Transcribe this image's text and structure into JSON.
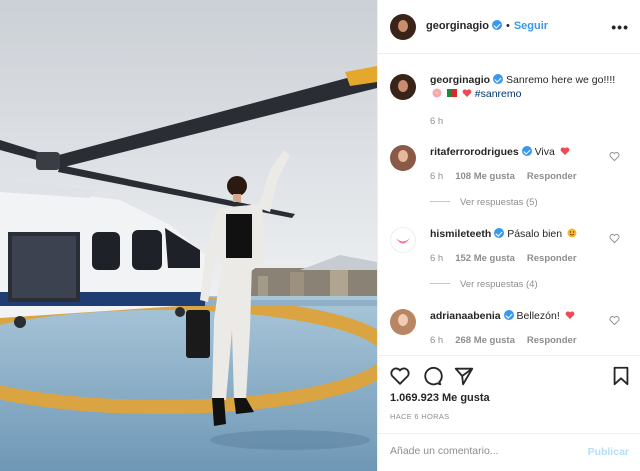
{
  "post": {
    "image_alt": "Woman posing in front of a helicopter on a helipad"
  },
  "header": {
    "username": "georginagio",
    "separator": "•",
    "follow_label": "Seguir",
    "more_label": "•••"
  },
  "caption": {
    "username": "georginagio",
    "text": "Sanremo here we go!!!!",
    "hashtag": "#sanremo",
    "age": "6 h"
  },
  "comments": [
    {
      "username": "ritaferrorodrigues",
      "text": "Viva",
      "age": "6 h",
      "likes": "108 Me gusta",
      "reply_label": "Responder",
      "replies_label": "Ver respuestas (5)"
    },
    {
      "username": "hismileteeth",
      "text": "Pásalo bien",
      "age": "6 h",
      "likes": "152 Me gusta",
      "reply_label": "Responder",
      "replies_label": "Ver respuestas (4)"
    },
    {
      "username": "adrianaabenia",
      "text": "Bellezón!",
      "age": "6 h",
      "likes": "268 Me gusta",
      "reply_label": "Responder"
    }
  ],
  "engagement": {
    "likes": "1.069.923 Me gusta",
    "posted": "HACE 6 HORAS"
  },
  "comment_box": {
    "placeholder": "Añade un comentario...",
    "submit_label": "Publicar"
  },
  "colors": {
    "accent": "#3897f0",
    "heart": "#ed4956",
    "muted": "#8e8e8e",
    "publish_disabled": "#b2dffc"
  },
  "icons": [
    "verified-icon",
    "heart-icon",
    "comment-icon",
    "share-icon",
    "bookmark-icon",
    "more-options-icon"
  ]
}
